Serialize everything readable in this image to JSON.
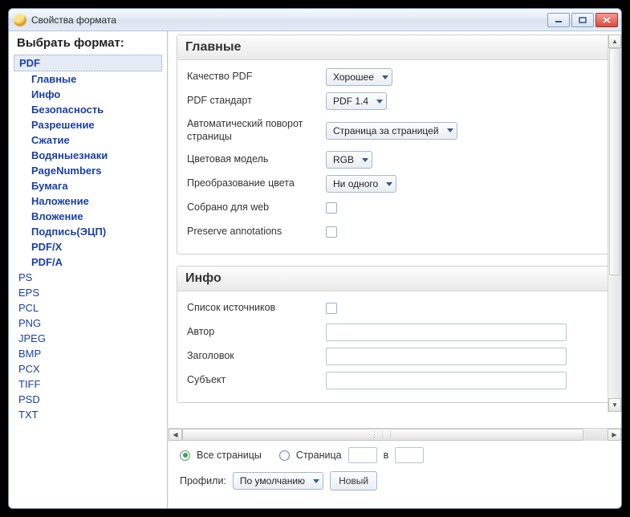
{
  "window": {
    "title": "Свойства формата"
  },
  "sidebar": {
    "title": "Выбрать формат:",
    "active_format": "PDF",
    "pdf_sub": [
      "Главные",
      "Инфо",
      "Безопасность",
      "Разрешение",
      "Сжатие",
      "Водяныезнаки",
      "PageNumbers",
      "Бумага",
      "Наложение",
      "Вложение",
      "Подпись(ЭЦП)",
      "PDF/X",
      "PDF/A"
    ],
    "formats": [
      "PS",
      "EPS",
      "PCL",
      "PNG",
      "JPEG",
      "BMP",
      "PCX",
      "TIFF",
      "PSD",
      "TXT"
    ]
  },
  "sections": {
    "main": {
      "title": "Главные",
      "rows": {
        "quality_label": "Качество PDF",
        "quality_value": "Хорошее",
        "standard_label": "PDF стандарт",
        "standard_value": "PDF 1.4",
        "autorotate_label": "Автоматический поворот страницы",
        "autorotate_value": "Страница за страницей",
        "colormodel_label": "Цветовая модель",
        "colormodel_value": "RGB",
        "colorconv_label": "Преобразование цвета",
        "colorconv_value": "Ни одного",
        "web_label": "Собрано для web",
        "preserve_label": "Preserve annotations"
      }
    },
    "info": {
      "title": "Инфо",
      "rows": {
        "sources_label": "Список источников",
        "author_label": "Автор",
        "title_label": "Заголовок",
        "subject_label": "Субъект"
      }
    }
  },
  "footer": {
    "all_pages": "Все страницы",
    "page_word": "Страница",
    "in_word": "в",
    "profiles_label": "Профили:",
    "profile_value": "По умолчанию",
    "new_btn": "Новый"
  }
}
